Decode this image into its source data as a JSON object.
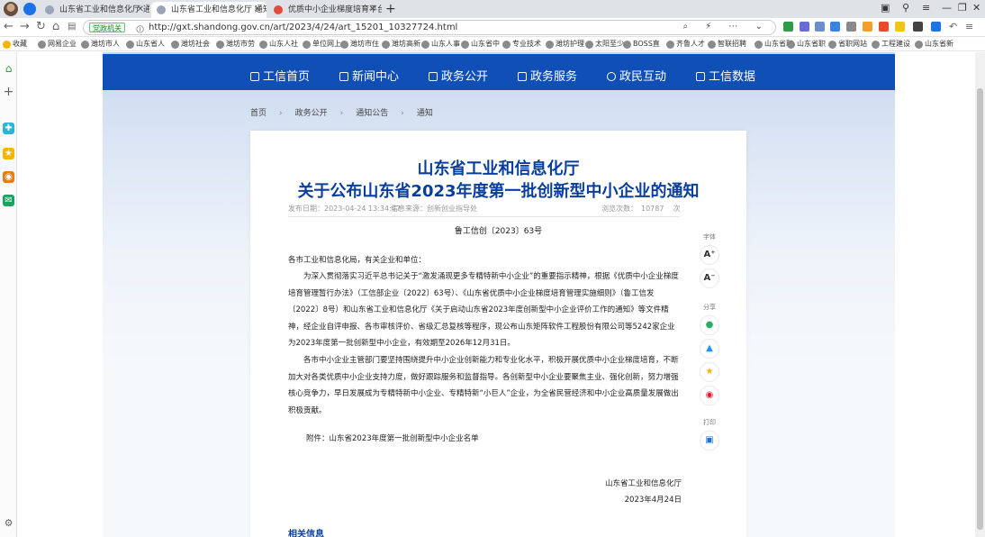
{
  "tabs": [
    {
      "label": "山东省工业和信息化厅 通知",
      "active": false
    },
    {
      "label": "山东省工业和信息化厅 通知 公",
      "active": true
    },
    {
      "label": "优质中小企业梯度培育平台",
      "active": false
    }
  ],
  "address": {
    "badge": "党政机关",
    "url": "http://gxt.shandong.gov.cn/art/2023/4/24/art_15201_10327724.html"
  },
  "bookmarks": [
    "收藏",
    "网易企业",
    "潍坊市人",
    "山东省人",
    "潍坊社会",
    "潍坊市劳",
    "山东人社",
    "单位网上",
    "潍坊市住",
    "潍坊高新",
    "山东人事",
    "山东省中",
    "专业技术",
    "潍坊护理",
    "太阳至少",
    "BOSS直",
    "齐鲁人才",
    "智联招聘",
    "山东省职",
    "山东省职",
    "省职网站",
    "工程建设",
    "山东省新"
  ],
  "nav": [
    "工信首页",
    "新闻中心",
    "政务公开",
    "政务服务",
    "政民互动",
    "工信数据"
  ],
  "breadcrumb": [
    "首页",
    "政务公开",
    "通知公告",
    "通知"
  ],
  "article": {
    "title_line1": "山东省工业和信息化厅",
    "title_line2": "关于公布山东省2023年度第一批创新型中小企业的通知",
    "publish_date": "发布日期：2023-04-24 13:34:47",
    "source": "信息来源：创新创业指导处",
    "views_label": "浏览次数：",
    "views": "10787",
    "views_unit": "次",
    "doc_number": "鲁工信创〔2023〕63号",
    "salutation": "各市工业和信息化局，有关企业和单位：",
    "para1": "为深入贯彻落实习近平总书记关于“激发涌现更多专精特新中小企业”的重要指示精神，根据《优质中小企业梯度培育管理暂行办法》（工信部企业〔2022〕63号）、《山东省优质中小企业梯度培育管理实施细则》（鲁工信发〔2022〕8号）和山东省工业和信息化厅《关于启动山东省2023年度创新型中小企业评价工作的通知》等文件精神，经企业自评申报、各市审核评价、省级汇总复核等程序，现公布山东矩阵软件工程股份有限公司等5242家企业为2023年度第一批创新型中小企业，有效期至2026年12月31日。",
    "para2": "各市中小企业主管部门要坚持围绕提升中小企业创新能力和专业化水平，积极开展优质中小企业梯度培育，不断加大对各类优质中小企业支持力度，做好跟踪服务和监督指导。各创新型中小企业要聚焦主业、强化创新，努力增强核心竞争力，早日发展成为专精特新中小企业、专精特新“小巨人”企业，为全省民营经济和中小企业高质量发展做出积极贡献。",
    "attachment": "附件：山东省2023年度第一批创新型中小企业名单",
    "signer": "山东省工业和信息化厅",
    "sign_date": "2023年4月24日"
  },
  "tools": {
    "font_label": "字体",
    "share_label": "分享",
    "print_label": "打印"
  },
  "related": "相关信息"
}
